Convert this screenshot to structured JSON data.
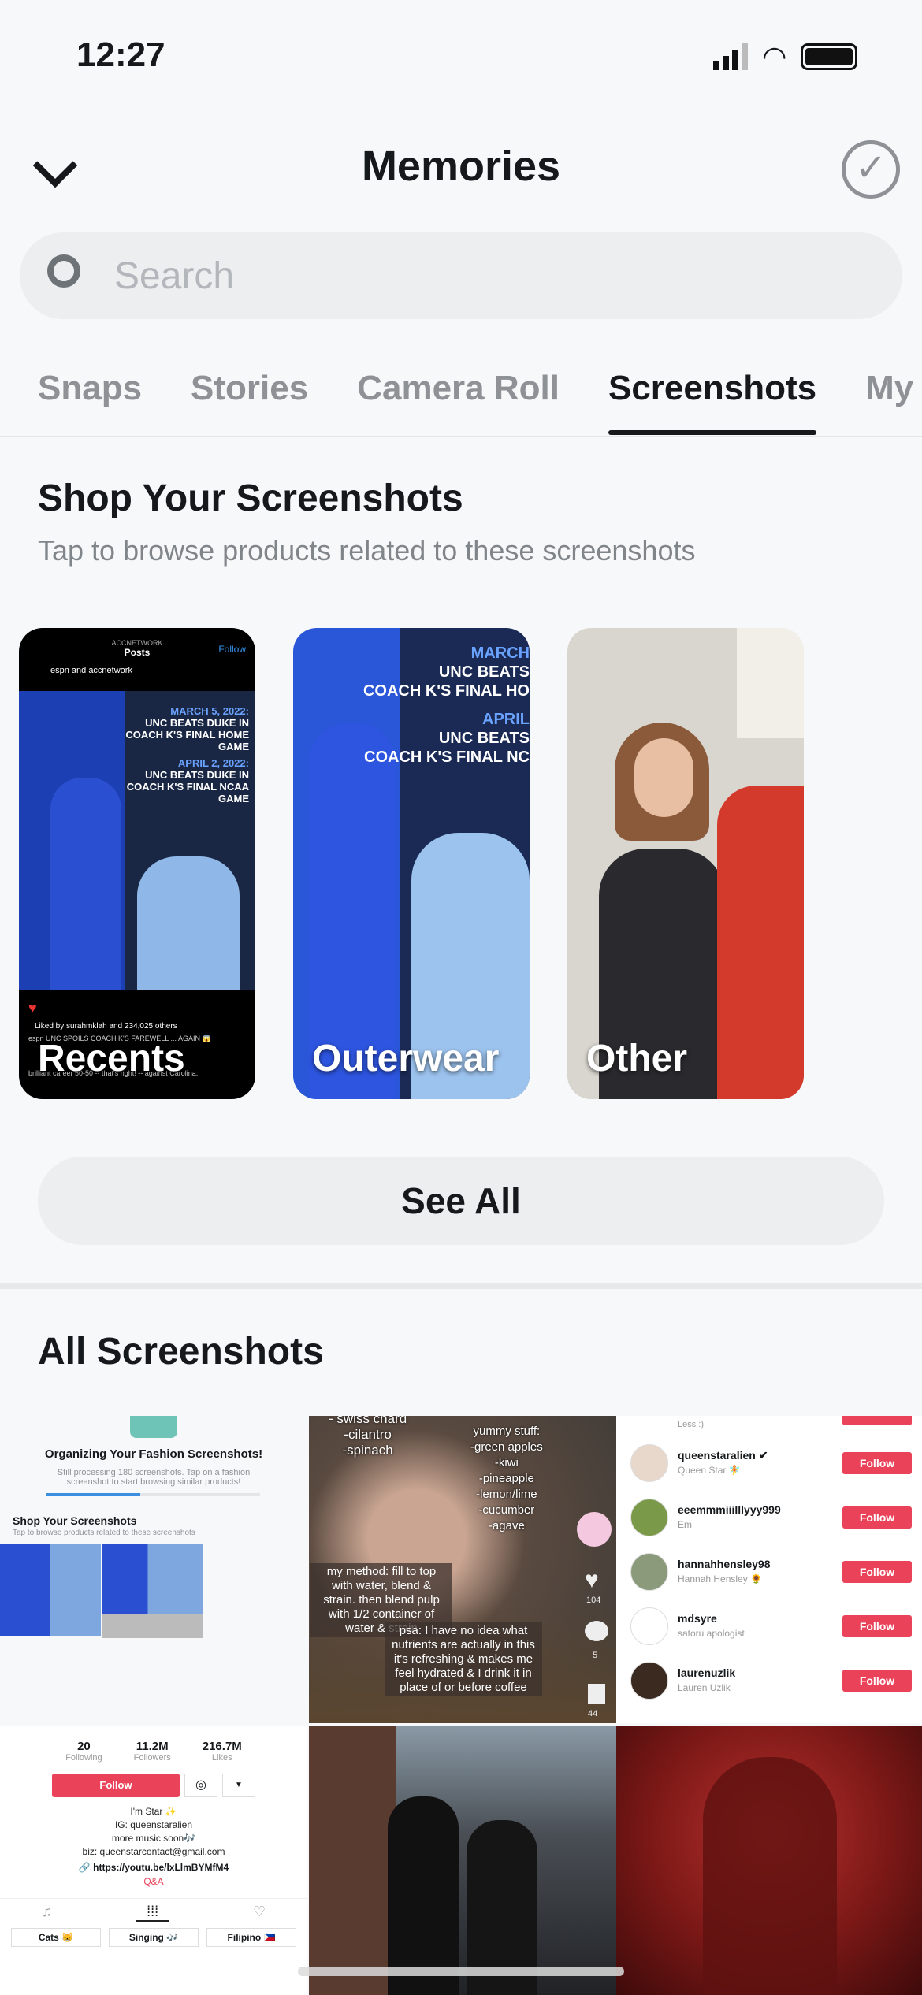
{
  "status": {
    "time": "12:27"
  },
  "header": {
    "title": "Memories"
  },
  "search": {
    "placeholder": "Search"
  },
  "tabs": [
    {
      "label": "Snaps"
    },
    {
      "label": "Stories"
    },
    {
      "label": "Camera Roll"
    },
    {
      "label": "Screenshots",
      "active": true
    },
    {
      "label": "My"
    }
  ],
  "shop": {
    "title": "Shop Your Screenshots",
    "subtitle": "Tap to browse products related to these screenshots",
    "cards": [
      {
        "label": "Recents"
      },
      {
        "label": "Outerwear"
      },
      {
        "label": "Other"
      }
    ],
    "recents_preview": {
      "account": "ACCNETWORK",
      "screen": "Posts",
      "follow": "Follow",
      "byline": "espn and accnetwork",
      "headline1_date": "MARCH 5, 2022:",
      "headline1": "UNC BEATS DUKE IN COACH K'S FINAL HOME GAME",
      "headline2_date": "APRIL 2, 2022:",
      "headline2": "UNC BEATS DUKE IN COACH K'S FINAL NCAA GAME",
      "likes": "Liked by surahmklah and 234,025 others",
      "caption": "espn UNC SPOILS COACH K'S FAREWELL ... AGAIN 😱",
      "comment": "brilliant career 50-50 -- that's right! -- against Carolina."
    },
    "outerwear_preview": {
      "line1": "MARCH",
      "line2": "UNC BEATS",
      "line3": "COACH K'S FINAL HO",
      "line4": "APRIL",
      "line5": "UNC BEATS",
      "line6": "COACH K'S FINAL NC"
    },
    "see_all": "See All"
  },
  "all": {
    "title": "All Screenshots",
    "t1": {
      "title": "Organizing Your Fashion Screenshots!",
      "body": "Still processing 180 screenshots. Tap on a fashion screenshot to start browsing similar products!",
      "progress": 0.44,
      "shop_title": "Shop Your Screenshots",
      "shop_sub": "Tap to browse products related to these screenshots"
    },
    "t2": {
      "list1": "- swiss chard\n-cilantro\n-spinach",
      "list2": "yummy stuff:\n-green apples\n-kiwi\n-pineapple\n-lemon/lime\n-cucumber\n-agave",
      "method": "my method: fill to top with water, blend & strain. then blend pulp with 1/2 container of water & strain",
      "psa": "psa: I have no idea what nutrients are actually in this it's refreshing & makes me feel hydrated & I drink it in place of or before coffee",
      "likes": "104",
      "comments": "5",
      "saves": "44"
    },
    "t3": {
      "top_sub": "Less :)",
      "follow": "Follow",
      "users": [
        {
          "name": "queenstaralien ✔",
          "sub": "Queen Star 🧚"
        },
        {
          "name": "eeemmmiiilllyyy999",
          "sub": "Em"
        },
        {
          "name": "hannahhensley98",
          "sub": "Hannah Hensley 🌻"
        },
        {
          "name": "mdsyre",
          "sub": "satoru apologist"
        },
        {
          "name": "laurenuzlik",
          "sub": "Lauren Uzlik"
        }
      ]
    },
    "t4": {
      "stats": [
        {
          "v": "20",
          "l": "Following"
        },
        {
          "v": "11.2M",
          "l": "Followers"
        },
        {
          "v": "216.7M",
          "l": "Likes"
        }
      ],
      "follow": "Follow",
      "bio": "I'm Star ✨\nIG: queenstaralien\nmore music soon🎶\nbiz: queenstarcontact@gmail.com",
      "link": "🔗 https://youtu.be/lxLlmBYMfM4",
      "qa": "Q&A",
      "playlists": [
        "Cats 😸",
        "Singing 🎶",
        "Filipino 🇵🇭"
      ]
    }
  },
  "colors": {
    "accent": "#16191c",
    "follow": "#ea4359",
    "progress": "#3b8fe0"
  }
}
